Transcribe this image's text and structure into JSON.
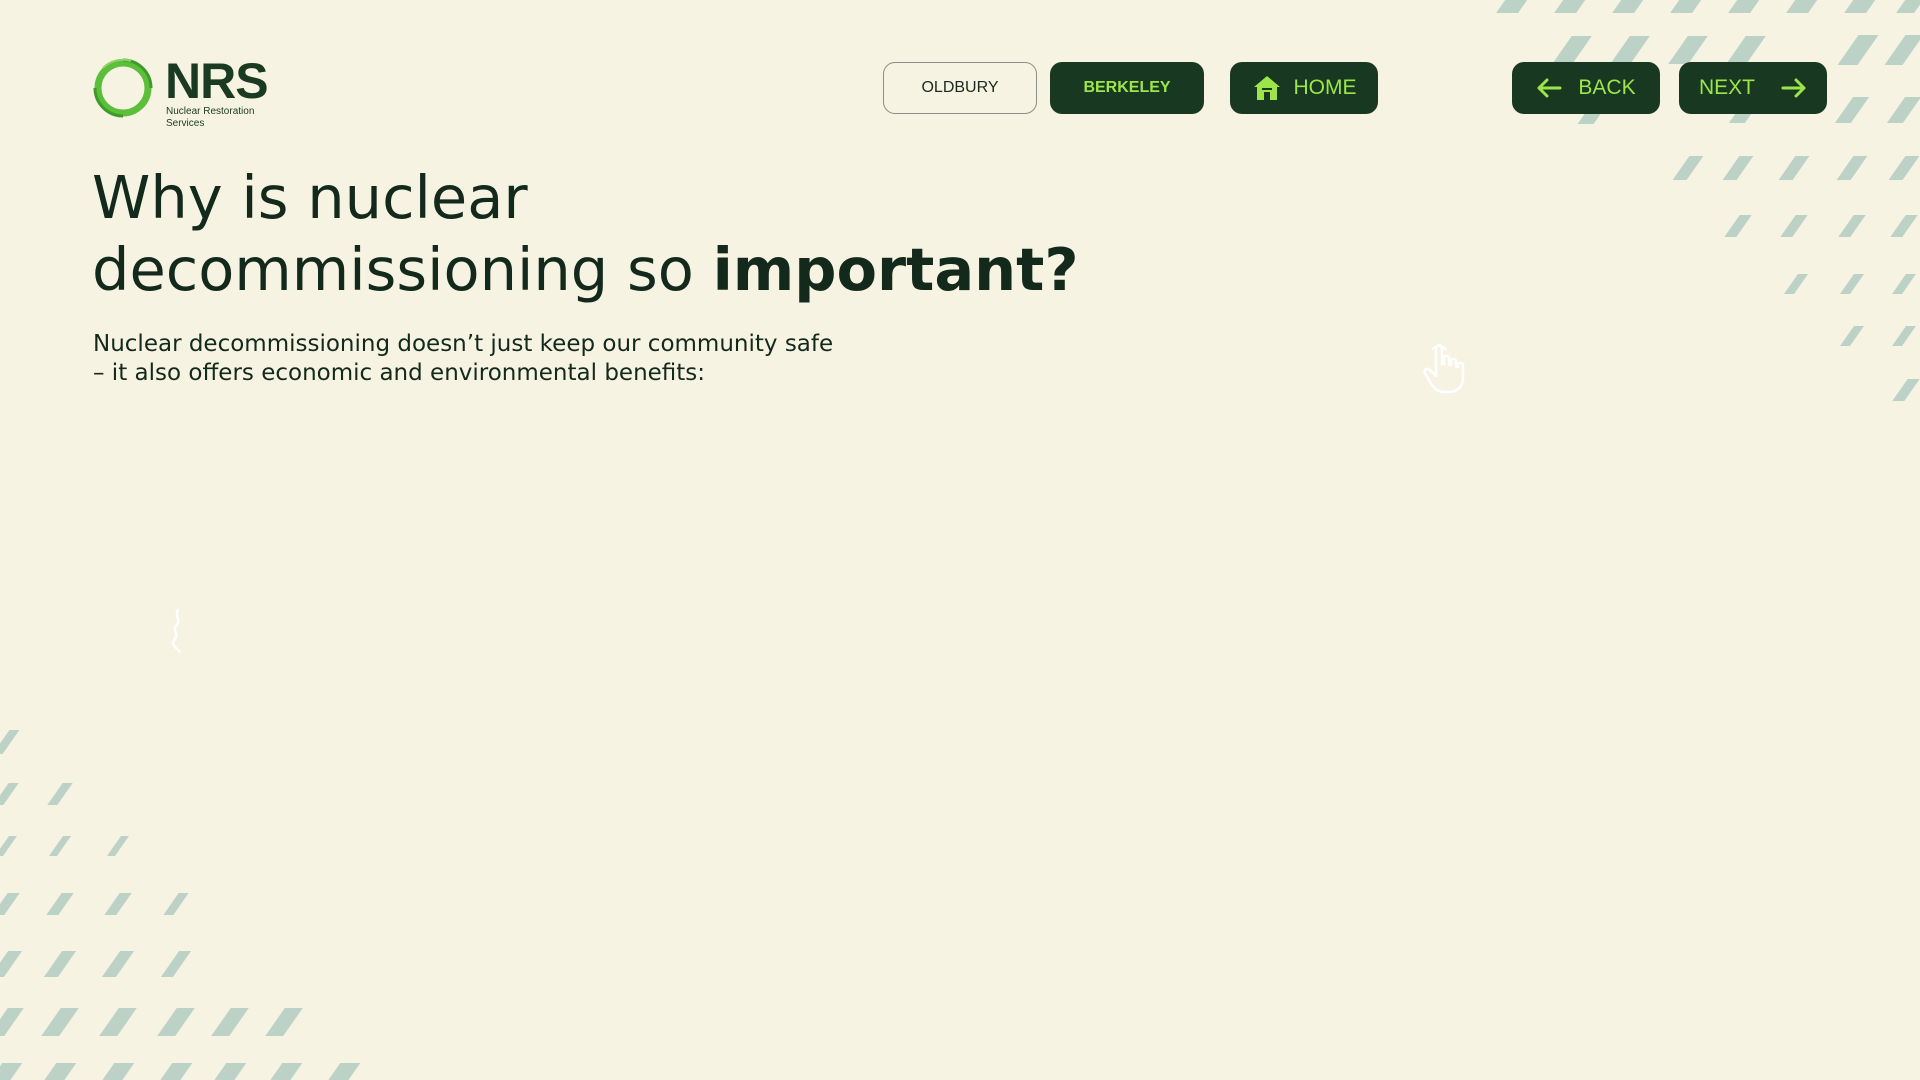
{
  "logo": {
    "wordmark": "NRS",
    "subtitle": "Nuclear Restoration Services",
    "colors": {
      "ring": "#5bbf3a",
      "text": "#1a3a22"
    }
  },
  "nav": {
    "oldbury_label": "OLDBURY",
    "berkeley_label": "BERKELEY",
    "home_label": "HOME",
    "back_label": "BACK",
    "next_label": "NEXT"
  },
  "heading": {
    "line1": "Why is nuclear",
    "line2_regular": "decommissioning so ",
    "line2_bold": "important?"
  },
  "intro": {
    "line1": "Nuclear decommissioning doesn’t just keep our community safe",
    "line2": "– it also offers economic and environmental benefits:"
  },
  "icons": {
    "home": "home-icon",
    "back": "arrow-left-icon",
    "next": "arrow-right-icon",
    "pointer": "hand-pointer-icon",
    "squiggle": "squiggle-icon"
  },
  "colors": {
    "background": "#f7f3e3",
    "dark_green": "#183821",
    "accent_green": "#9de64a",
    "pattern": "#bcd2c6"
  }
}
